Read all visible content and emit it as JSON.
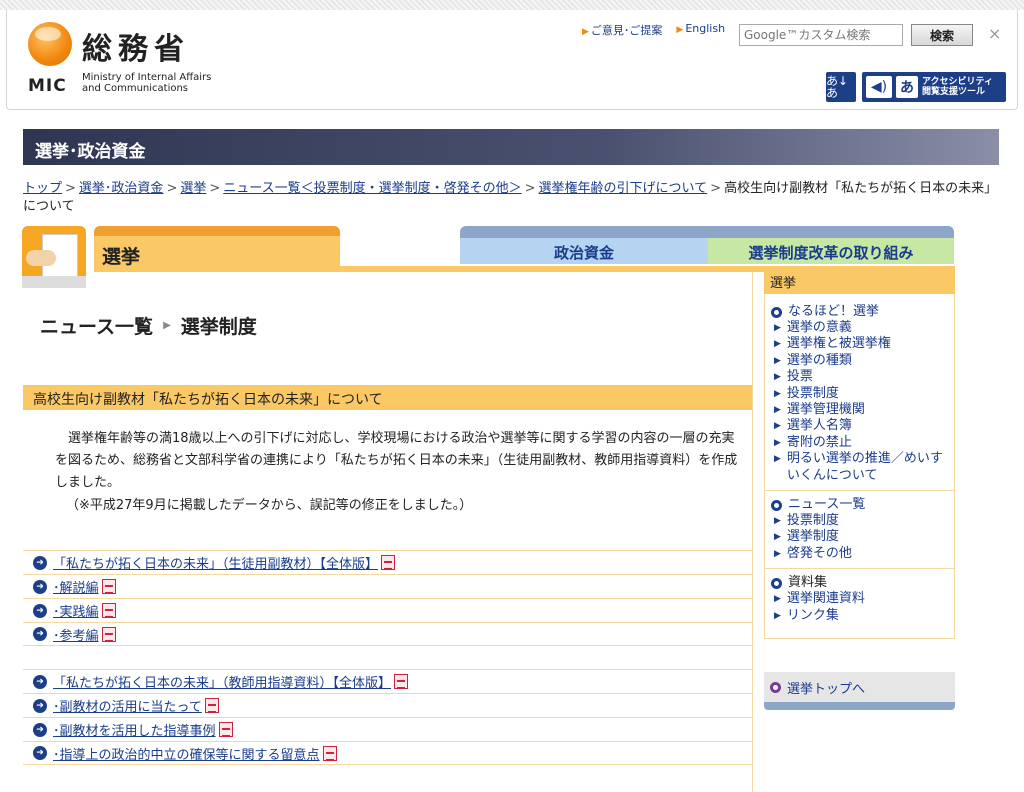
{
  "header": {
    "logo_kanji": "総務省",
    "logo_mic": "MIC",
    "logo_en_line1": "Ministry of Internal Affairs",
    "logo_en_line2": "and Communications",
    "link_opinion": "ご意見･ご提案",
    "link_english": "English",
    "search_placeholder": "Google™カスタム検索",
    "search_button": "検索",
    "close": "×",
    "furigana_label": "あ↓あ",
    "accessibility_line1": "アクセシビリティ",
    "accessibility_line2": "閲覧支援ツール"
  },
  "section_title": "選挙･政治資金",
  "breadcrumb": {
    "items": [
      "トップ",
      "選挙･政治資金",
      "選挙",
      "ニュース一覧＜投票制度・選挙制度・啓発その他＞",
      "選挙権年齢の引下げについて"
    ],
    "current": "高校生向け副教材「私たちが拓く日本の未来」について"
  },
  "tabs": {
    "election": "選挙",
    "politics": "政治資金",
    "reform": "選挙制度改革の取り組み"
  },
  "page_title": {
    "news": "ニュース一覧",
    "category": "選挙制度"
  },
  "article": {
    "heading": "高校生向け副教材「私たちが拓く日本の未来」について",
    "body": "選挙権年齢等の満18歳以上への引下げに対応し、学校現場における政治や選挙等に関する学習の内容の一層の充実を図るため、総務省と文部科学省の連携により「私たちが拓く日本の未来」（生徒用副教材、教師用指導資料）を作成しました。",
    "note": "（※平成27年9月に掲載したデータから、誤記等の修正をしました。）"
  },
  "student_docs": [
    "「私たちが拓く日本の未来」（生徒用副教材）【全体版】",
    "･解説編",
    "･実践編",
    "･参考編"
  ],
  "teacher_docs": [
    "「私たちが拓く日本の未来」（教師用指導資料）【全体版】",
    "･副教材の活用に当たって",
    "･副教材を活用した指導事例",
    "･指導上の政治的中立の確保等に関する留意点"
  ],
  "sidebar": {
    "heading": "選挙",
    "group1_title": "なるほど！選挙",
    "group1_items": [
      "選挙の意義",
      "選挙権と被選挙権",
      "選挙の種類",
      "投票",
      "投票制度",
      "選挙管理機関",
      "選挙人名簿",
      "寄附の禁止",
      "明るい選挙の推進／めいすいくんについて"
    ],
    "group2_title": "ニュース一覧",
    "group2_items": [
      "投票制度",
      "選挙制度",
      "啓発その他"
    ],
    "group3_title": "資料集",
    "group3_items": [
      "選挙関連資料",
      "リンク集"
    ],
    "top_link": "選挙トップへ"
  },
  "colors": {
    "accent_orange": "#fbc866",
    "navy": "#1d3f88",
    "link": "#1a3c8c"
  }
}
